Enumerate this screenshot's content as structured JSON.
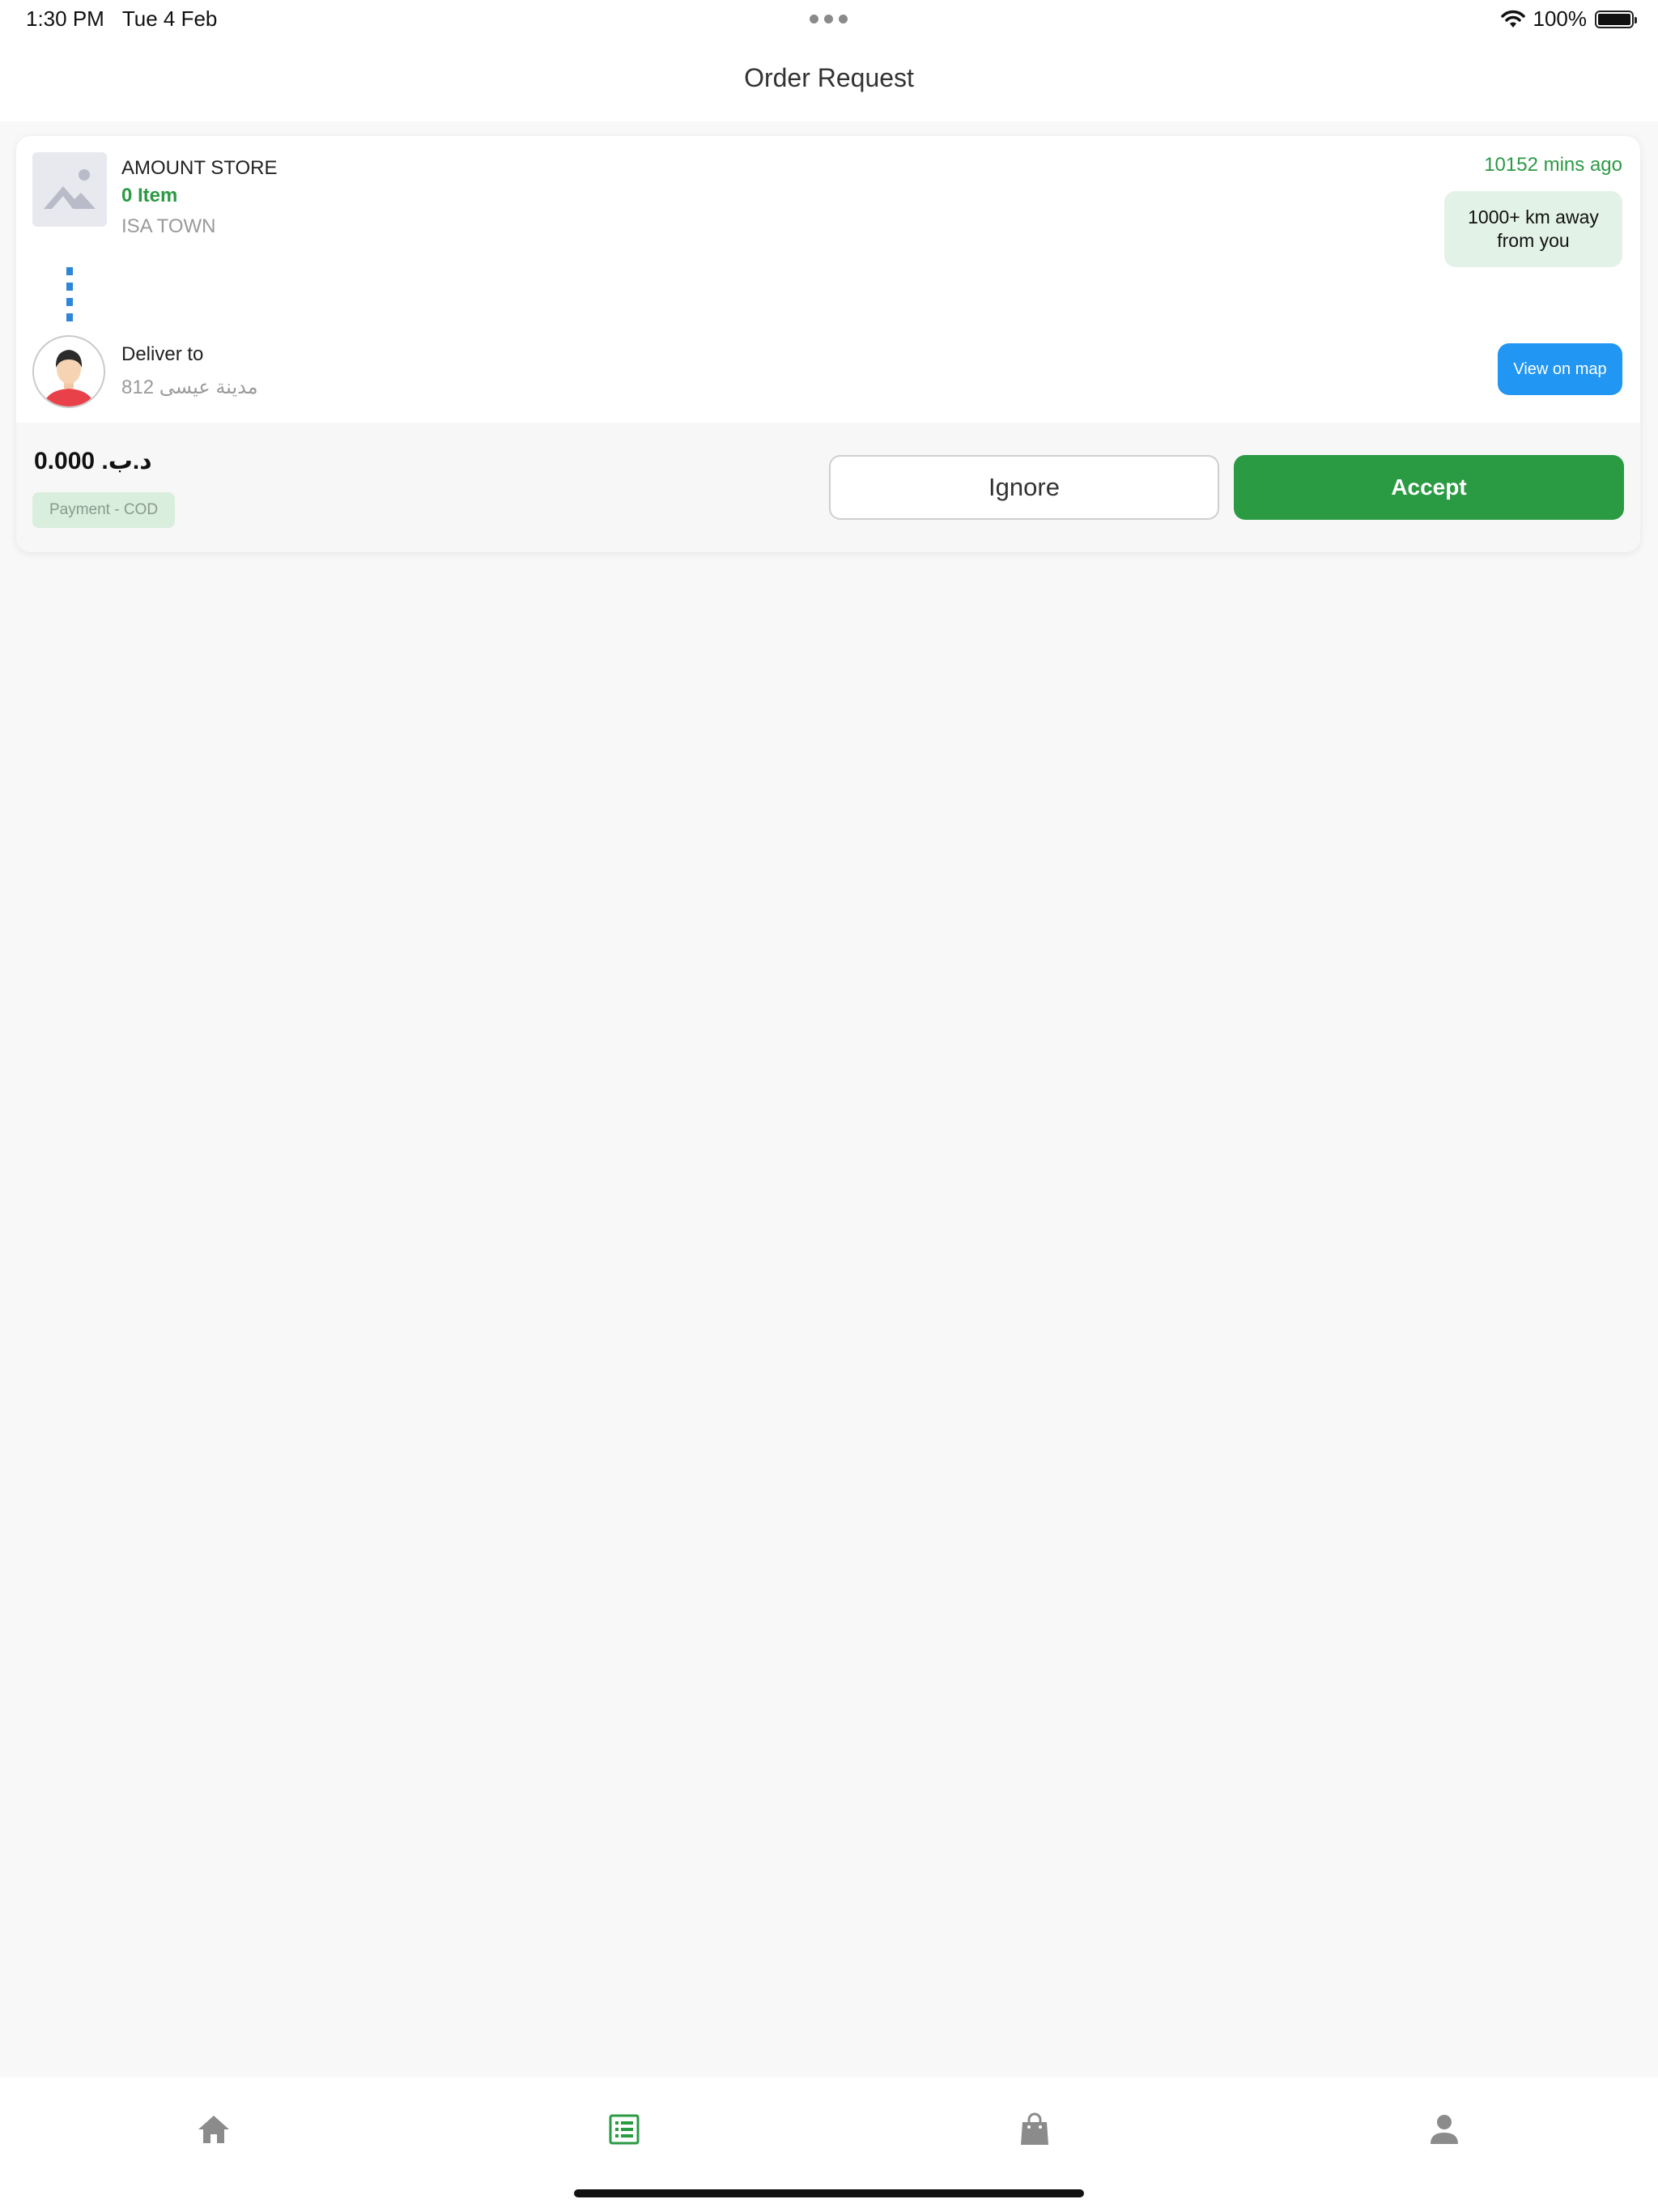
{
  "status_bar": {
    "time": "1:30 PM",
    "date": "Tue 4 Feb",
    "battery": "100%",
    "icons": [
      "wifi-icon",
      "battery-icon"
    ]
  },
  "header": {
    "title": "Order Request"
  },
  "order": {
    "store_name": "AMOUNT STORE",
    "item_count": "0 Item",
    "store_city": "ISA TOWN",
    "time_ago": "10152 mins ago",
    "distance": "1000+ km away from you",
    "deliver_label": "Deliver to",
    "deliver_address": "812 مدينة عيسى",
    "view_map_label": "View on map",
    "price": "0.000 .د.ب",
    "payment": "Payment - COD",
    "ignore_label": "Ignore",
    "accept_label": "Accept"
  },
  "tab_bar": {
    "tabs": [
      {
        "icon": "home-icon",
        "active": false
      },
      {
        "icon": "list-icon",
        "active": true
      },
      {
        "icon": "shopping-bag-icon",
        "active": false
      },
      {
        "icon": "person-icon",
        "active": false
      }
    ]
  },
  "colors": {
    "accent_green": "#2a9a43",
    "map_blue": "#2196f3",
    "badge_green": "#e3f2e6"
  }
}
